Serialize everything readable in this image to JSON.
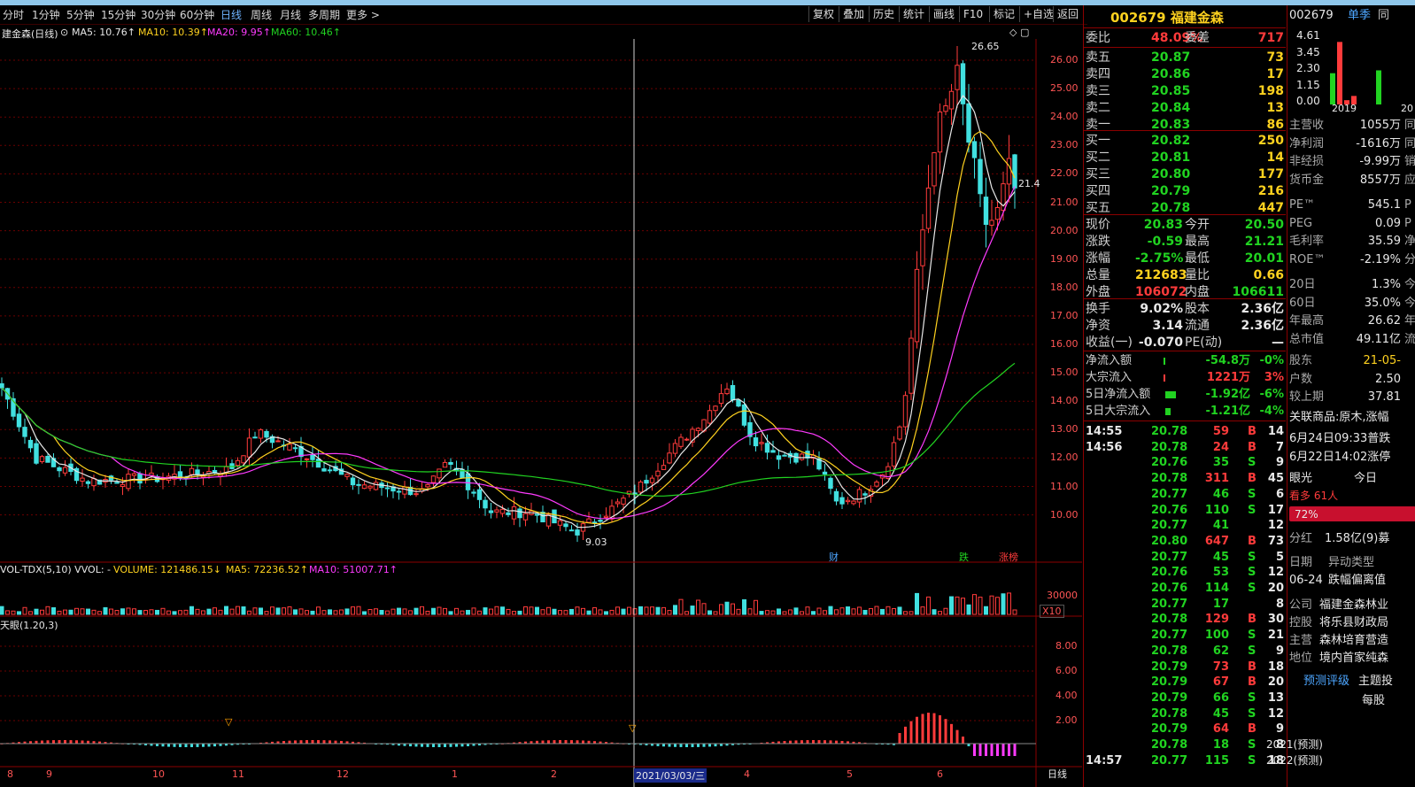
{
  "toolbar": {
    "periods": [
      "分时",
      "1分钟",
      "5分钟",
      "15分钟",
      "30分钟",
      "60分钟",
      "日线",
      "周线",
      "月线",
      "多周期",
      "更多 >"
    ],
    "selected": "日线",
    "right_buttons": [
      "复权",
      "叠加",
      "历史",
      "统计",
      "画线",
      "F10",
      "标记",
      "+自选",
      "返回"
    ]
  },
  "chart": {
    "stock_title": "建金森(日线)",
    "ma_labels": [
      {
        "text": "MA5: 10.76↑",
        "color": "#e8e8e8"
      },
      {
        "text": "MA10: 10.39↑",
        "color": "#ffd21f"
      },
      {
        "text": "MA20: 9.95↑",
        "color": "#ff3bff"
      },
      {
        "text": "MA60: 10.46↑",
        "color": "#21d321"
      }
    ],
    "price_axis": [
      "26.00",
      "25.00",
      "24.00",
      "23.00",
      "22.00",
      "21.00",
      "20.00",
      "19.00",
      "18.00",
      "17.00",
      "16.00",
      "15.00",
      "14.00",
      "13.00",
      "12.00",
      "11.00",
      "10.00"
    ],
    "high_label": "26.65",
    "low_label": "9.03",
    "cur_label": "21.4",
    "event_tags": [
      {
        "text": "财",
        "color": "#4da6ff"
      },
      {
        "text": "跌",
        "color": "#21d321"
      },
      {
        "text": "涨榜",
        "color": "#ff3b3b"
      }
    ],
    "volume_title": "VOL-TDX(5,10) VVOL: -",
    "volume_values": [
      {
        "text": "VOLUME: 121486.15↓",
        "color": "#ffd21f"
      },
      {
        "text": "MA5: 72236.52↑",
        "color": "#ffd21f"
      },
      {
        "text": "MA10: 51007.71↑",
        "color": "#ff3bff"
      }
    ],
    "volume_axis": "30000",
    "volume_unit": "X10",
    "ind_title": "天眼(1.20,3)",
    "ind_axis": [
      "8.00",
      "6.00",
      "4.00",
      "2.00"
    ],
    "date_labels": [
      "8",
      "9",
      "10",
      "11",
      "12",
      "1",
      "2",
      "2021/03/03/三",
      "4",
      "5",
      "6"
    ],
    "bottom_right_label": "日线"
  },
  "quote": {
    "code": "002679",
    "name": "福建金森",
    "weibi": {
      "label": "委比",
      "value": "48.09%",
      "label2": "委差",
      "value2": "717"
    },
    "sells": [
      {
        "label": "卖五",
        "price": "20.87",
        "vol": "73"
      },
      {
        "label": "卖四",
        "price": "20.86",
        "vol": "17"
      },
      {
        "label": "卖三",
        "price": "20.85",
        "vol": "198"
      },
      {
        "label": "卖二",
        "price": "20.84",
        "vol": "13"
      },
      {
        "label": "卖一",
        "price": "20.83",
        "vol": "86"
      }
    ],
    "buys": [
      {
        "label": "买一",
        "price": "20.82",
        "vol": "250"
      },
      {
        "label": "买二",
        "price": "20.81",
        "vol": "14"
      },
      {
        "label": "买三",
        "price": "20.80",
        "vol": "177"
      },
      {
        "label": "买四",
        "price": "20.79",
        "vol": "216"
      },
      {
        "label": "买五",
        "price": "20.78",
        "vol": "447"
      }
    ],
    "stats": [
      {
        "l1": "现价",
        "v1": "20.83",
        "c1": "#21d321",
        "l2": "今开",
        "v2": "20.50",
        "c2": "#21d321"
      },
      {
        "l1": "涨跌",
        "v1": "-0.59",
        "c1": "#21d321",
        "l2": "最高",
        "v2": "21.21",
        "c2": "#21d321"
      },
      {
        "l1": "涨幅",
        "v1": "-2.75%",
        "c1": "#21d321",
        "l2": "最低",
        "v2": "20.01",
        "c2": "#21d321"
      },
      {
        "l1": "总量",
        "v1": "212683",
        "c1": "#ffd21f",
        "l2": "量比",
        "v2": "0.66",
        "c2": "#ffd21f"
      },
      {
        "l1": "外盘",
        "v1": "106072",
        "c1": "#ff3b3b",
        "l2": "内盘",
        "v2": "106611",
        "c2": "#21d321"
      }
    ],
    "stats2": [
      {
        "l1": "换手",
        "v1": "9.02%",
        "l2": "股本",
        "v2": "2.36亿"
      },
      {
        "l1": "净资",
        "v1": "3.14",
        "l2": "流通",
        "v2": "2.36亿"
      },
      {
        "l1": "收益(一)",
        "v1": "-0.070",
        "l2": "PE(动)",
        "v2": "—"
      }
    ],
    "flows": [
      {
        "label": "净流入额",
        "value": "-54.8万",
        "pct": "-0%",
        "vc": "#21d321",
        "pc": "#21d321",
        "bar": "#21d321"
      },
      {
        "label": "大宗流入",
        "value": "1221万",
        "pct": "3%",
        "vc": "#ff3b3b",
        "pc": "#ff3b3b",
        "bar": "#ff3b3b"
      },
      {
        "label": "5日净流入额",
        "value": "-1.92亿",
        "pct": "-6%",
        "vc": "#21d321",
        "pc": "#21d321",
        "bar": "#21d321"
      },
      {
        "label": "5日大宗流入",
        "value": "-1.21亿",
        "pct": "-4%",
        "vc": "#21d321",
        "pc": "#21d321",
        "bar": "#21d321"
      }
    ],
    "ticks": [
      {
        "t": "14:55",
        "p": "20.78",
        "v": "59",
        "bs": "B",
        "n": "14"
      },
      {
        "t": "14:56",
        "p": "20.78",
        "v": "24",
        "bs": "B",
        "n": "7"
      },
      {
        "t": "",
        "p": "20.76",
        "v": "35",
        "bs": "S",
        "n": "9"
      },
      {
        "t": "",
        "p": "20.78",
        "v": "311",
        "bs": "B",
        "n": "45"
      },
      {
        "t": "",
        "p": "20.77",
        "v": "46",
        "bs": "S",
        "n": "6"
      },
      {
        "t": "",
        "p": "20.76",
        "v": "110",
        "bs": "S",
        "n": "17"
      },
      {
        "t": "",
        "p": "20.77",
        "v": "41",
        "bs": "",
        "n": "12"
      },
      {
        "t": "",
        "p": "20.80",
        "v": "647",
        "bs": "B",
        "n": "73"
      },
      {
        "t": "",
        "p": "20.77",
        "v": "45",
        "bs": "S",
        "n": "5"
      },
      {
        "t": "",
        "p": "20.76",
        "v": "53",
        "bs": "S",
        "n": "12"
      },
      {
        "t": "",
        "p": "20.76",
        "v": "114",
        "bs": "S",
        "n": "20"
      },
      {
        "t": "",
        "p": "20.77",
        "v": "17",
        "bs": "",
        "n": "8"
      },
      {
        "t": "",
        "p": "20.78",
        "v": "129",
        "bs": "B",
        "n": "30"
      },
      {
        "t": "",
        "p": "20.77",
        "v": "100",
        "bs": "S",
        "n": "21"
      },
      {
        "t": "",
        "p": "20.78",
        "v": "62",
        "bs": "S",
        "n": "9"
      },
      {
        "t": "",
        "p": "20.79",
        "v": "73",
        "bs": "B",
        "n": "18"
      },
      {
        "t": "",
        "p": "20.79",
        "v": "67",
        "bs": "B",
        "n": "20"
      },
      {
        "t": "",
        "p": "20.79",
        "v": "66",
        "bs": "S",
        "n": "13"
      },
      {
        "t": "",
        "p": "20.78",
        "v": "45",
        "bs": "S",
        "n": "12"
      },
      {
        "t": "",
        "p": "20.79",
        "v": "64",
        "bs": "B",
        "n": "9"
      },
      {
        "t": "",
        "p": "20.78",
        "v": "18",
        "bs": "S",
        "n": "8"
      },
      {
        "t": "14:57",
        "p": "20.77",
        "v": "115",
        "bs": "S",
        "n": "18"
      }
    ]
  },
  "finance": {
    "code": "002679",
    "tabs": [
      "单季",
      "同"
    ],
    "bar_axis": [
      "4.61",
      "3.45",
      "2.30",
      "1.15",
      "0.00"
    ],
    "bar_years": [
      "2019",
      "20"
    ],
    "rows1": [
      {
        "l": "主营收",
        "v": "1055万",
        "s": "同"
      },
      {
        "l": "净利润",
        "v": "-1616万",
        "s": "同"
      },
      {
        "l": "非经损",
        "v": "-9.99万",
        "s": "销"
      },
      {
        "l": "货币金",
        "v": "8557万",
        "s": "应"
      }
    ],
    "rows2": [
      {
        "l": "PE™",
        "v": "545.1",
        "s": "P"
      },
      {
        "l": "PEG",
        "v": "0.09",
        "s": "P"
      },
      {
        "l": "毛利率",
        "v": "35.59",
        "s": "净"
      },
      {
        "l": "ROE™",
        "v": "-2.19%",
        "s": "分"
      }
    ],
    "rows3": [
      {
        "l": "20日",
        "v": "1.3%",
        "s": "今"
      },
      {
        "l": "60日",
        "v": "35.0%",
        "s": "今"
      },
      {
        "l": "年最高",
        "v": "26.62",
        "s": "年"
      },
      {
        "l": "总市值",
        "v": "49.11亿",
        "s": "流"
      }
    ],
    "holders": [
      {
        "l": "股东",
        "v": "21-05-",
        "vc": "#ffd21f"
      },
      {
        "l": "户数",
        "v": "2.50",
        "vc": "#e8e8e8"
      },
      {
        "l": "较上期",
        "v": "37.81",
        "vc": "#e8e8e8"
      }
    ],
    "related": "关联商品:原木,涨幅",
    "news": [
      "6月24日09:33普跌",
      "6月22日14:02涨停"
    ],
    "eye": {
      "label": "眼光",
      "day": "今日",
      "people": "看多 61人",
      "pct": "72%"
    },
    "dividend": {
      "l": "分红",
      "v": "1.58亿(9)募"
    },
    "abnormal": {
      "h1": "日期",
      "h2": "异动类型",
      "d": "06-24",
      "t": "跌幅偏离值"
    },
    "company": [
      {
        "l": "公司",
        "v": "福建金森林业"
      },
      {
        "l": "控股",
        "v": "将乐县财政局"
      },
      {
        "l": "主营",
        "v": "森林培育营造"
      },
      {
        "l": "地位",
        "v": "境内首家纯森"
      }
    ],
    "forecast": {
      "label": "预测评级",
      "theme": "主题投",
      "eps": "每股"
    },
    "forecast_years": [
      "2021(预测)",
      "2022(预测)"
    ]
  }
}
